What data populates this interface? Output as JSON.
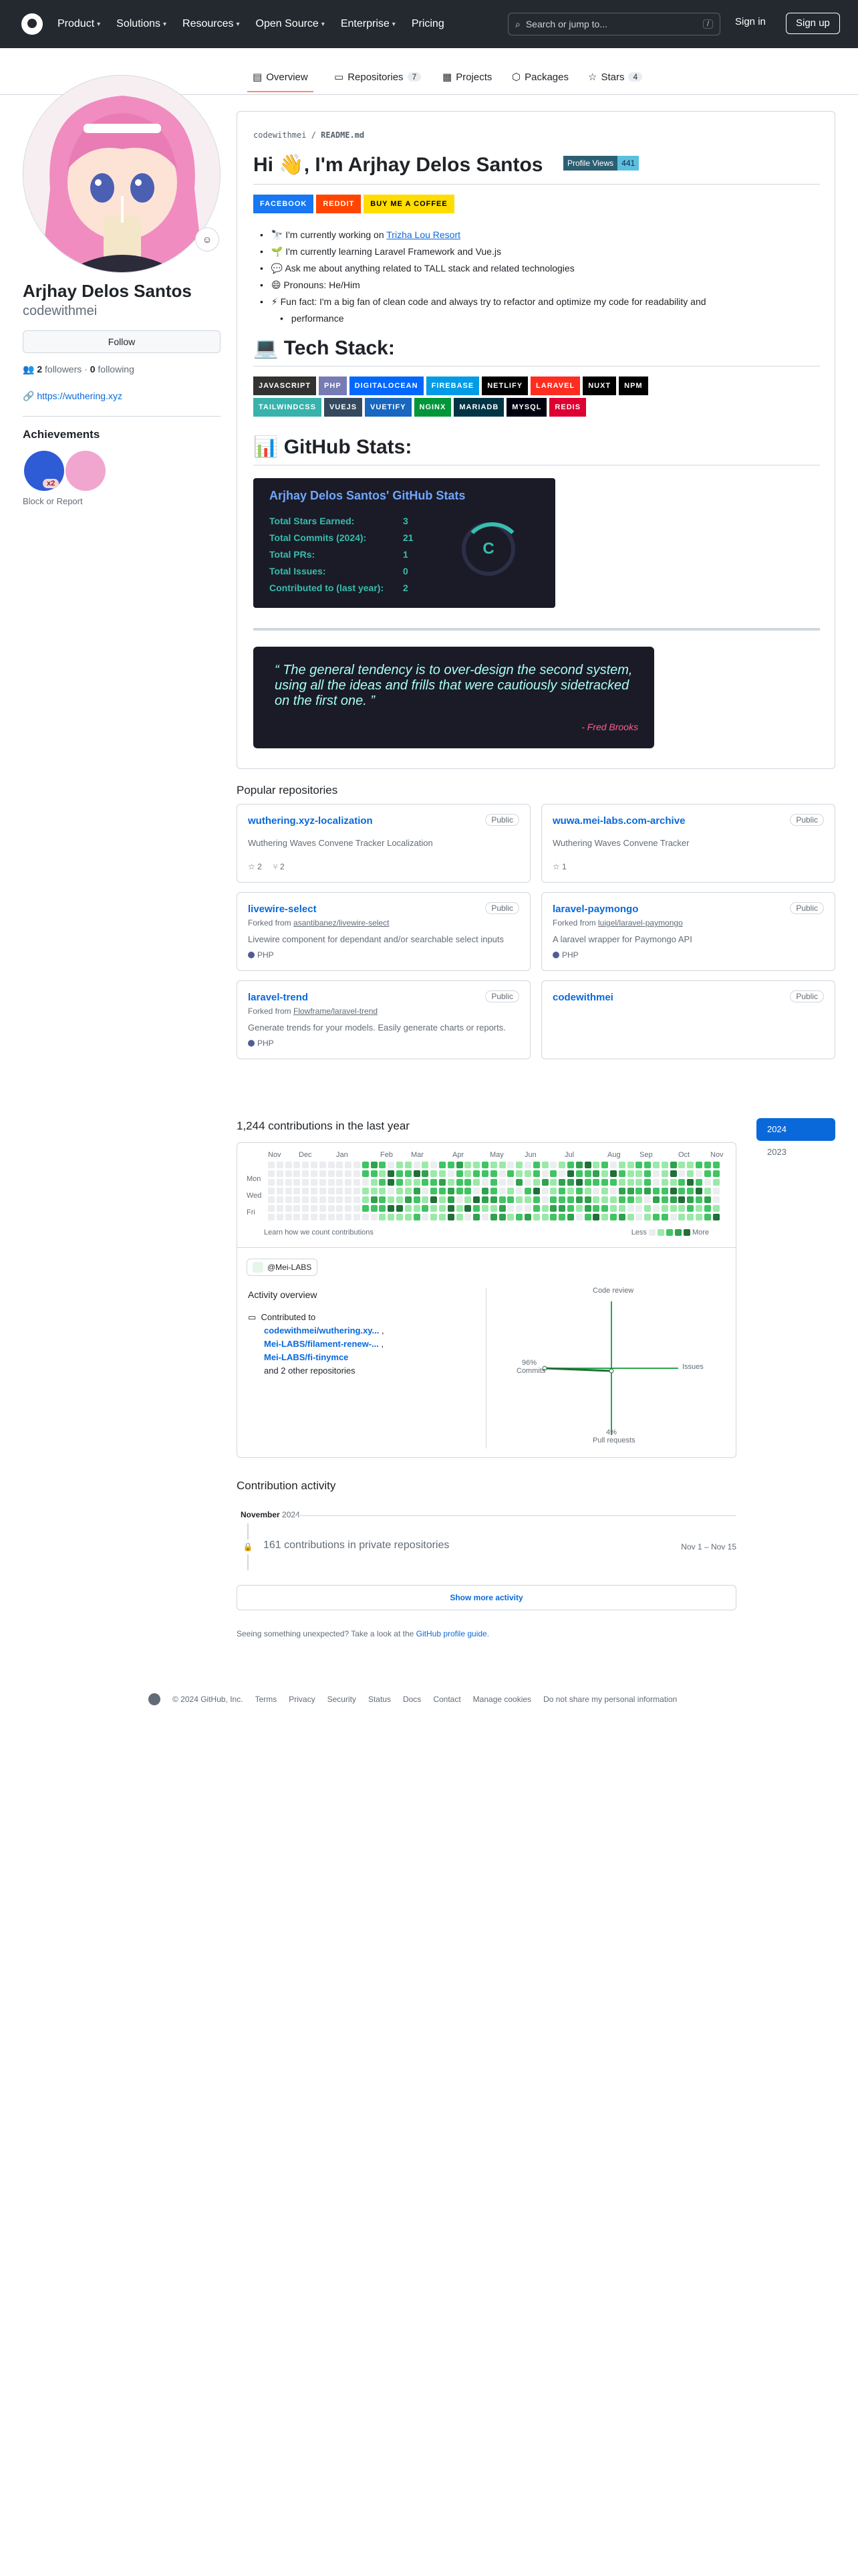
{
  "header": {
    "nav": [
      "Product",
      "Solutions",
      "Resources",
      "Open Source",
      "Enterprise",
      "Pricing"
    ],
    "search_placeholder": "Search or jump to...",
    "search_shortcut": "/",
    "sign_in": "Sign in",
    "sign_up": "Sign up"
  },
  "tabs": [
    {
      "label": "Overview",
      "count": ""
    },
    {
      "label": "Repositories",
      "count": "7"
    },
    {
      "label": "Projects",
      "count": ""
    },
    {
      "label": "Packages",
      "count": ""
    },
    {
      "label": "Stars",
      "count": "4"
    }
  ],
  "profile": {
    "name": "Arjhay Delos Santos",
    "login": "codewithmei",
    "follow": "Follow",
    "followers": "2",
    "followers_label": "followers",
    "following": "0",
    "following_label": "following",
    "website": "https://wuthering.xyz",
    "achievements_title": "Achievements",
    "badge_count": "x2",
    "block": "Block or Report"
  },
  "readme": {
    "path_user": "codewithmei",
    "path_file": "README.md",
    "title": "Hi 👋, I'm Arjhay Delos Santos",
    "views_label": "Profile Views",
    "views_count": "441",
    "social": [
      {
        "label": "FACEBOOK",
        "color": "#1877f2"
      },
      {
        "label": "REDDIT",
        "color": "#ff4500"
      },
      {
        "label": "BUY ME A COFFEE",
        "color": "#ffdd00"
      }
    ],
    "bullets": [
      {
        "pre": "🔭 I'm currently working on ",
        "link": "Trizha Lou Resort"
      },
      {
        "pre": "🌱 I'm currently learning Laravel Framework and Vue.js",
        "link": ""
      },
      {
        "pre": "💬 Ask me about anything related to TALL stack and related technologies",
        "link": ""
      },
      {
        "pre": "😄 Pronouns: He/Him",
        "link": ""
      },
      {
        "pre": "⚡ Fun fact: I'm a big fan of clean code and always try to refactor and optimize my code for readability and",
        "link": ""
      },
      {
        "pre": "performance",
        "link": ""
      }
    ],
    "tech_title": "💻 Tech Stack:",
    "tech_row1": [
      {
        "label": "JAVASCRIPT",
        "color": "#323330"
      },
      {
        "label": "PHP",
        "color": "#777bb4"
      },
      {
        "label": "DIGITALOCEAN",
        "color": "#0167ff"
      },
      {
        "label": "FIREBASE",
        "color": "#039be5"
      },
      {
        "label": "NETLIFY",
        "color": "#000000"
      },
      {
        "label": "LARAVEL",
        "color": "#ff2d20"
      },
      {
        "label": "NUXT",
        "color": "#000000"
      },
      {
        "label": "NPM",
        "color": "#000000"
      }
    ],
    "tech_row2": [
      {
        "label": "TAILWINDCSS",
        "color": "#38b2ac"
      },
      {
        "label": "VUEJS",
        "color": "#35495e"
      },
      {
        "label": "VUETIFY",
        "color": "#1867c0"
      },
      {
        "label": "NGINX",
        "color": "#009639"
      },
      {
        "label": "MARIADB",
        "color": "#003545"
      },
      {
        "label": "MYSQL",
        "color": "#00000f"
      },
      {
        "label": "REDIS",
        "color": "#dd0031"
      }
    ],
    "stats_title": "📊 GitHub Stats:",
    "stats": {
      "heading": "Arjhay Delos Santos' GitHub Stats",
      "rows": [
        {
          "label": "Total Stars Earned:",
          "value": "3"
        },
        {
          "label": "Total Commits (2024):",
          "value": "21"
        },
        {
          "label": "Total PRs:",
          "value": "1"
        },
        {
          "label": "Total Issues:",
          "value": "0"
        },
        {
          "label": "Contributed to (last year):",
          "value": "2"
        }
      ],
      "rank": "C"
    },
    "quote": "“ The general tendency is to over-design the second system, using all the ideas and frills that were cautiously sidetracked on the first one. ”",
    "quote_author": "- Fred Brooks"
  },
  "popular": {
    "title": "Popular repositories",
    "repos": [
      {
        "name": "wuthering.xyz-localization",
        "vis": "Public",
        "fork": "",
        "fork_src": "",
        "desc": "Wuthering Waves Convene Tracker Localization",
        "stars": "2",
        "forks": "2",
        "lang": ""
      },
      {
        "name": "wuwa.mei-labs.com-archive",
        "vis": "Public",
        "fork": "",
        "fork_src": "",
        "desc": "Wuthering Waves Convene Tracker",
        "stars": "1",
        "forks": "",
        "lang": ""
      },
      {
        "name": "livewire-select",
        "vis": "Public",
        "fork": "Forked from ",
        "fork_src": "asantibanez/livewire-select",
        "desc": "Livewire component for dependant and/or searchable select inputs",
        "stars": "",
        "forks": "",
        "lang": "PHP"
      },
      {
        "name": "laravel-paymongo",
        "vis": "Public",
        "fork": "Forked from ",
        "fork_src": "luigel/laravel-paymongo",
        "desc": "A laravel wrapper for Paymongo API",
        "stars": "",
        "forks": "",
        "lang": "PHP"
      },
      {
        "name": "laravel-trend",
        "vis": "Public",
        "fork": "Forked from ",
        "fork_src": "Flowframe/laravel-trend",
        "desc": "Generate trends for your models. Easily generate charts or reports.",
        "stars": "",
        "forks": "",
        "lang": "PHP"
      },
      {
        "name": "codewithmei",
        "vis": "Public",
        "fork": "",
        "fork_src": "",
        "desc": "",
        "stars": "",
        "forks": "",
        "lang": ""
      }
    ]
  },
  "contrib": {
    "title": "1,244 contributions in the last year",
    "months": [
      "Nov",
      "Dec",
      "Jan",
      "Feb",
      "Mar",
      "Apr",
      "May",
      "Jun",
      "Jul",
      "Aug",
      "Sep",
      "Oct",
      "Nov"
    ],
    "days": [
      "Mon",
      "Wed",
      "Fri"
    ],
    "learn": "Learn how we count contributions",
    "less": "Less",
    "more": "More",
    "years": [
      "2024",
      "2023"
    ],
    "org": "@Mei-LABS",
    "overview_title": "Activity overview",
    "contributed_to": "Contributed to",
    "repos": [
      "codewithmei/wuthering.xy...",
      "Mei-LABS/filament-renew-...",
      "Mei-LABS/fi-tinymce"
    ],
    "others": "and 2 other repositories",
    "radar": {
      "code_review": "Code review",
      "issues": "Issues",
      "pr_pct": "4%",
      "pr": "Pull requests",
      "commits_pct": "96%",
      "commits": "Commits"
    }
  },
  "activity": {
    "title": "Contribution activity",
    "month": "November",
    "year": "2024",
    "item": "161 contributions in private repositories",
    "range": "Nov 1 – Nov 15",
    "more": "Show more activity",
    "hint": "Seeing something unexpected? Take a look at the ",
    "hint_link": "GitHub profile guide",
    "hint_end": "."
  },
  "footer": {
    "copyright": "© 2024 GitHub, Inc.",
    "links": [
      "Terms",
      "Privacy",
      "Security",
      "Status",
      "Docs",
      "Contact",
      "Manage cookies",
      "Do not share my personal information"
    ]
  }
}
